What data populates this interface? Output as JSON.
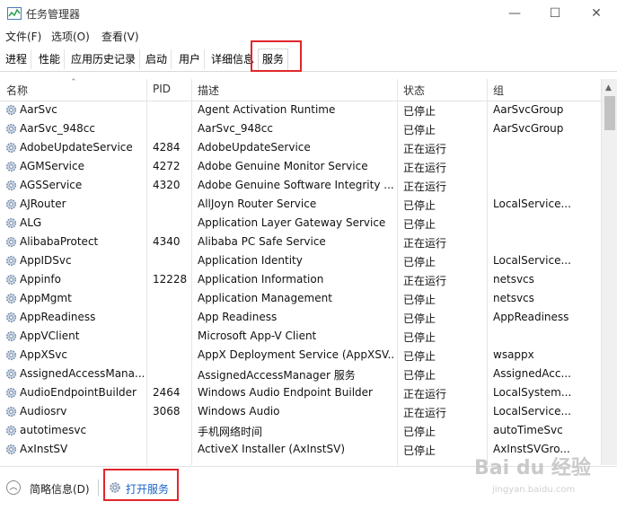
{
  "window": {
    "title": "任务管理器",
    "minimize": "—",
    "maximize": "☐",
    "close": "✕"
  },
  "menu": [
    "文件(F)",
    "选项(O)",
    "查看(V)"
  ],
  "tabs": [
    "进程",
    "性能",
    "应用历史记录",
    "启动",
    "用户",
    "详细信息",
    "服务"
  ],
  "active_tab": "服务",
  "columns": {
    "name": "名称",
    "pid": "PID",
    "desc": "描述",
    "status": "状态",
    "group": "组"
  },
  "services": [
    {
      "name": "AarSvc",
      "pid": "",
      "desc": "Agent Activation Runtime",
      "status": "已停止",
      "group": "AarSvcGroup"
    },
    {
      "name": "AarSvc_948cc",
      "pid": "",
      "desc": "AarSvc_948cc",
      "status": "已停止",
      "group": "AarSvcGroup"
    },
    {
      "name": "AdobeUpdateService",
      "pid": "4284",
      "desc": "AdobeUpdateService",
      "status": "正在运行",
      "group": ""
    },
    {
      "name": "AGMService",
      "pid": "4272",
      "desc": "Adobe Genuine Monitor Service",
      "status": "正在运行",
      "group": ""
    },
    {
      "name": "AGSService",
      "pid": "4320",
      "desc": "Adobe Genuine Software Integrity ...",
      "status": "正在运行",
      "group": ""
    },
    {
      "name": "AJRouter",
      "pid": "",
      "desc": "AllJoyn Router Service",
      "status": "已停止",
      "group": "LocalService..."
    },
    {
      "name": "ALG",
      "pid": "",
      "desc": "Application Layer Gateway Service",
      "status": "已停止",
      "group": ""
    },
    {
      "name": "AlibabaProtect",
      "pid": "4340",
      "desc": "Alibaba PC Safe Service",
      "status": "正在运行",
      "group": ""
    },
    {
      "name": "AppIDSvc",
      "pid": "",
      "desc": "Application Identity",
      "status": "已停止",
      "group": "LocalService..."
    },
    {
      "name": "Appinfo",
      "pid": "12228",
      "desc": "Application Information",
      "status": "正在运行",
      "group": "netsvcs"
    },
    {
      "name": "AppMgmt",
      "pid": "",
      "desc": "Application Management",
      "status": "已停止",
      "group": "netsvcs"
    },
    {
      "name": "AppReadiness",
      "pid": "",
      "desc": "App Readiness",
      "status": "已停止",
      "group": "AppReadiness"
    },
    {
      "name": "AppVClient",
      "pid": "",
      "desc": "Microsoft App-V Client",
      "status": "已停止",
      "group": ""
    },
    {
      "name": "AppXSvc",
      "pid": "",
      "desc": "AppX Deployment Service (AppXSV...",
      "status": "已停止",
      "group": "wsappx"
    },
    {
      "name": "AssignedAccessMana...",
      "pid": "",
      "desc": "AssignedAccessManager 服务",
      "status": "已停止",
      "group": "AssignedAcc..."
    },
    {
      "name": "AudioEndpointBuilder",
      "pid": "2464",
      "desc": "Windows Audio Endpoint Builder",
      "status": "正在运行",
      "group": "LocalSystem..."
    },
    {
      "name": "Audiosrv",
      "pid": "3068",
      "desc": "Windows Audio",
      "status": "正在运行",
      "group": "LocalService..."
    },
    {
      "name": "autotimesvc",
      "pid": "",
      "desc": "手机网络时间",
      "status": "已停止",
      "group": "autoTimeSvc"
    },
    {
      "name": "AxInstSV",
      "pid": "",
      "desc": "ActiveX Installer (AxInstSV)",
      "status": "已停止",
      "group": "AxInstSVGro..."
    }
  ],
  "footer": {
    "fewer_details": "简略信息(D)",
    "open_services": "打开服务"
  },
  "watermark": {
    "main": "Bai du 经验",
    "sub": "jingyan.baidu.com"
  }
}
